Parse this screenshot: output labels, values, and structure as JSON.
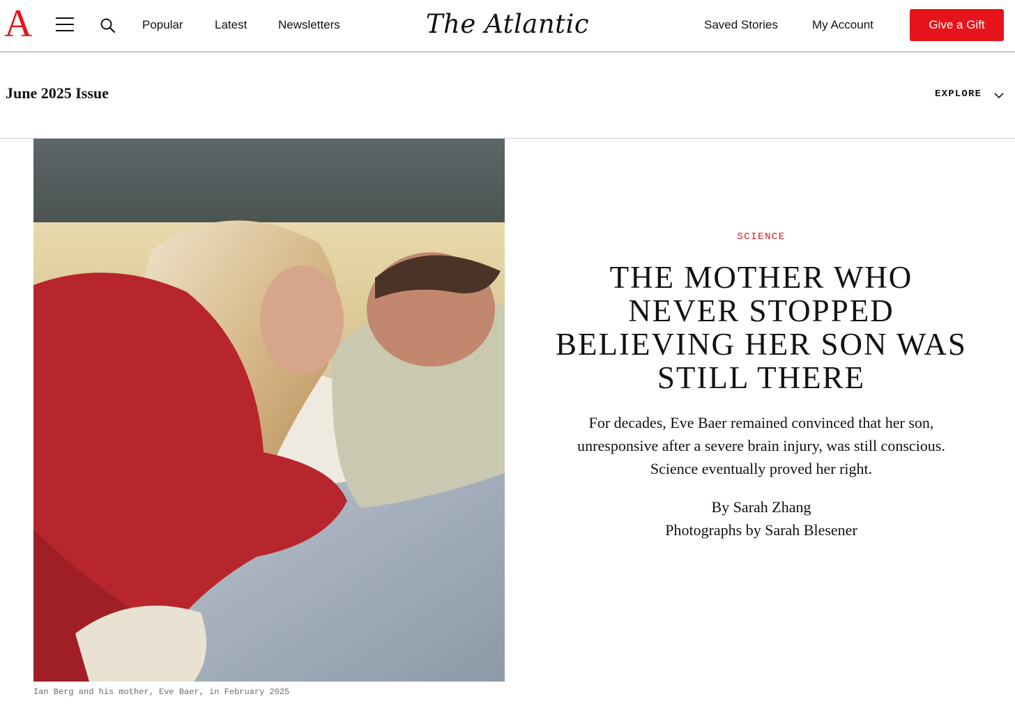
{
  "header": {
    "logo_letter": "A",
    "wordmark": "The Atlantic",
    "nav_left": [
      "Popular",
      "Latest",
      "Newsletters"
    ],
    "nav_right": [
      "Saved Stories",
      "My Account"
    ],
    "gift_button": "Give a Gift",
    "icons": [
      "menu-icon",
      "search-icon"
    ]
  },
  "issue_bar": {
    "title": "June 2025 Issue",
    "explore_label": "EXPLORE",
    "explore_icon": "chevron-down-icon"
  },
  "hero": {
    "caption": "Ian Berg and his mother, Eve Baer, in February 2025"
  },
  "article": {
    "section": "SCIENCE",
    "headline": "The Mother Who Never Stopped Believing Her Son Was Still There",
    "dek": "For decades, Eve Baer remained convinced that her son, unresponsive after a severe brain injury, was still conscious. Science eventually proved her right.",
    "byline": "By Sarah Zhang",
    "photo_credit": "Photographs by Sarah Blesener"
  },
  "colors": {
    "brand_red": "#e7131a",
    "text": "#111111",
    "caption_gray": "#6b6b6b"
  }
}
